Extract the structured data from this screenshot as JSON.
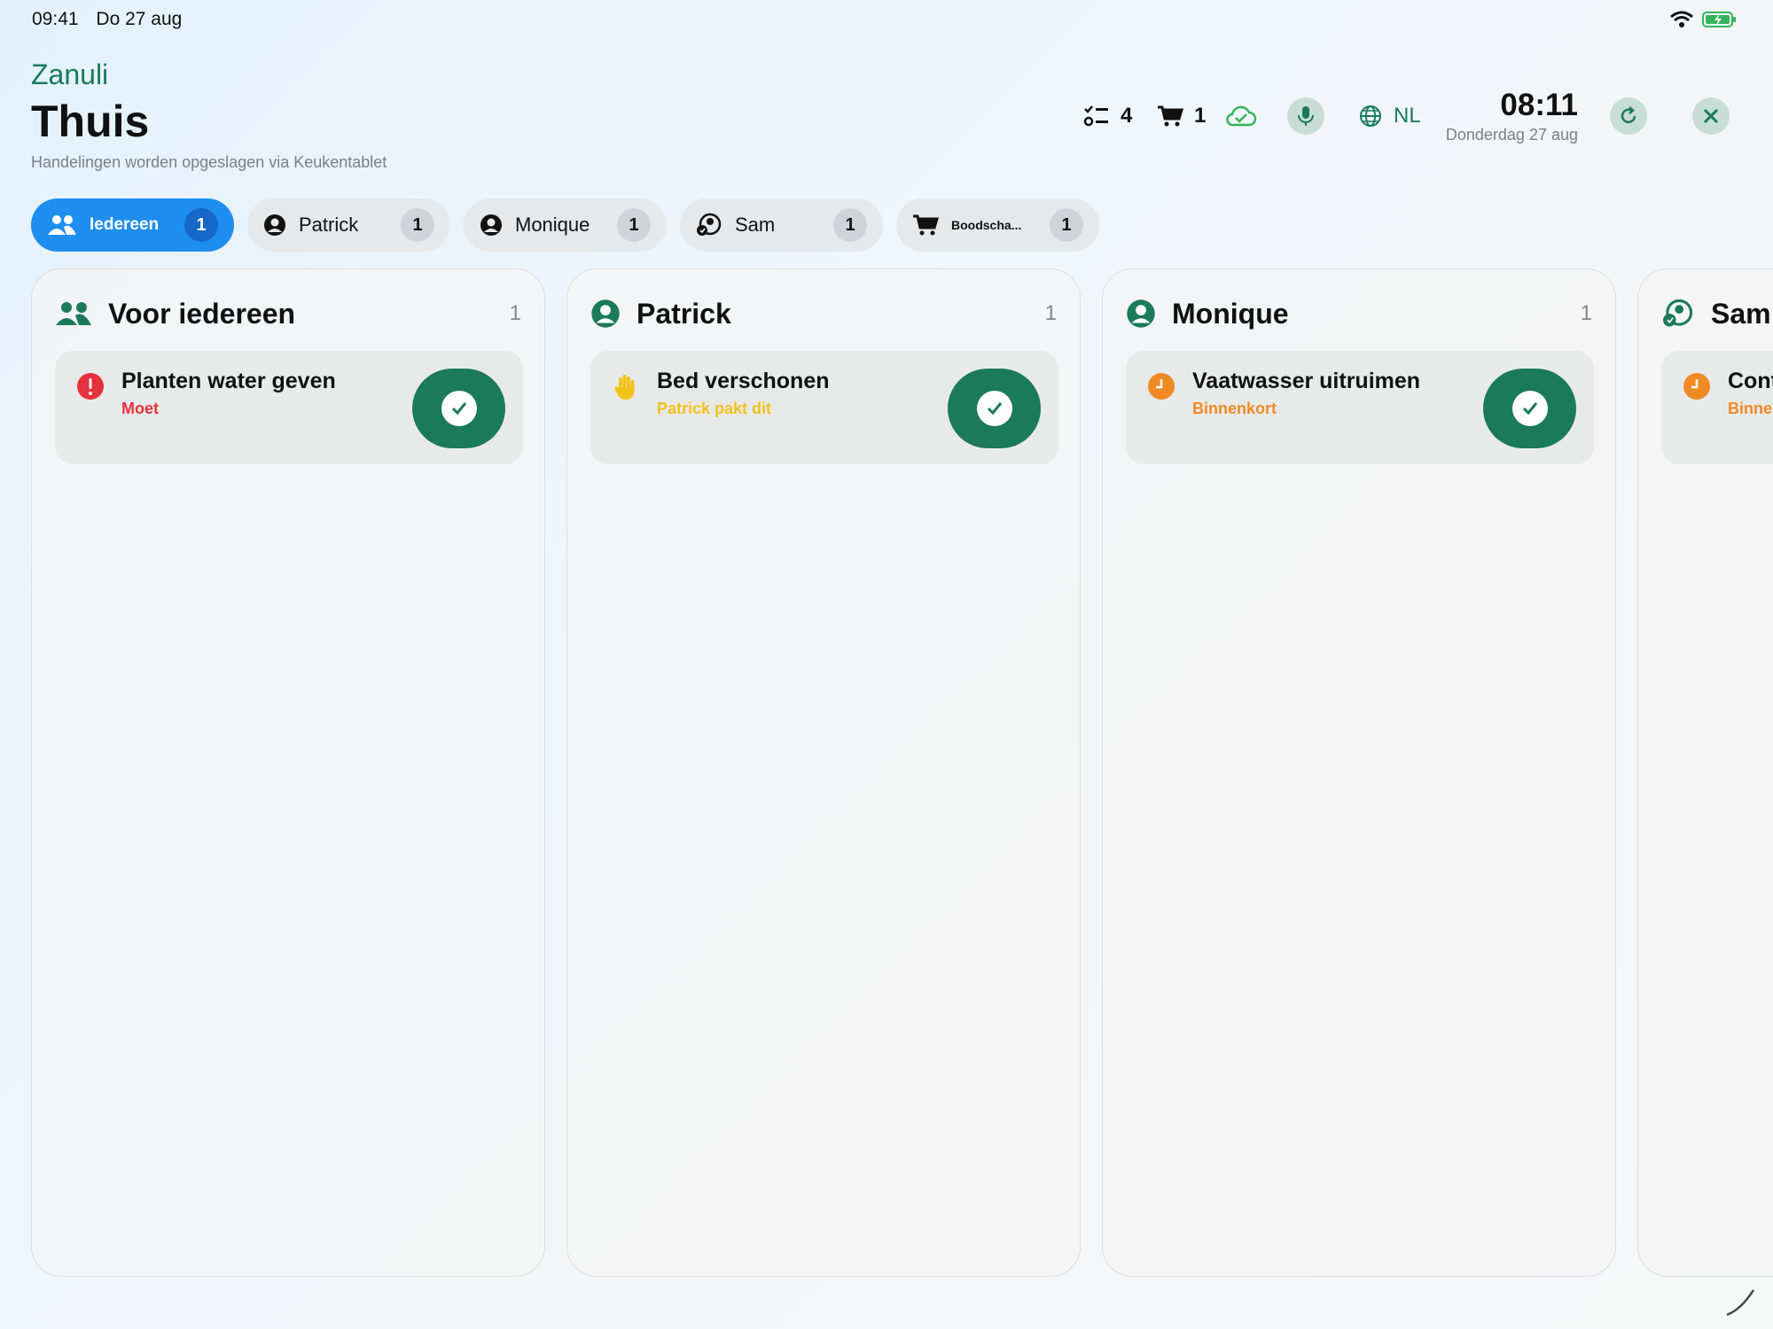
{
  "statusbar": {
    "time": "09:41",
    "date": "Do 27 aug"
  },
  "header": {
    "app_name": "Zanuli",
    "title": "Thuis",
    "subtitle": "Handelingen worden opgeslagen via Keukentablet"
  },
  "topbar": {
    "tasks_count": "4",
    "cart_count": "1",
    "language": "NL",
    "clock_time": "08:11",
    "clock_date": "Donderdag 27 aug"
  },
  "tabs": [
    {
      "label": "Iedereen",
      "count": "1",
      "icon": "people-icon",
      "active": true
    },
    {
      "label": "Patrick",
      "count": "1",
      "icon": "person-icon"
    },
    {
      "label": "Monique",
      "count": "1",
      "icon": "person-icon"
    },
    {
      "label": "Sam",
      "count": "1",
      "icon": "person-badge-icon"
    },
    {
      "label": "Boodscha...",
      "count": "1",
      "icon": "cart-icon"
    }
  ],
  "columns": [
    {
      "title": "Voor iedereen",
      "count": "1",
      "icon": "people-icon",
      "task": {
        "title": "Planten water geven",
        "status": "Moet",
        "status_color": "#e5323c",
        "icon": "exclamation-icon"
      }
    },
    {
      "title": "Patrick",
      "count": "1",
      "icon": "person-icon",
      "task": {
        "title": "Bed verschonen",
        "status": "Patrick pakt dit",
        "status_color": "#f2c21b",
        "icon": "raised-hand-icon"
      }
    },
    {
      "title": "Monique",
      "count": "1",
      "icon": "person-icon",
      "task": {
        "title": "Vaatwasser uitruimen",
        "status": "Binnenkort",
        "status_color": "#f08a24",
        "icon": "clock-icon"
      }
    },
    {
      "title": "Sam",
      "count": "",
      "icon": "person-badge-icon",
      "task": {
        "title": "Cont",
        "status": "Binne",
        "status_color": "#f08a24",
        "icon": "clock-icon"
      }
    }
  ],
  "colors": {
    "brand_green": "#1b7a5a",
    "active_tab_blue": "#1f8ef1",
    "cloud_green": "#35b45a"
  }
}
